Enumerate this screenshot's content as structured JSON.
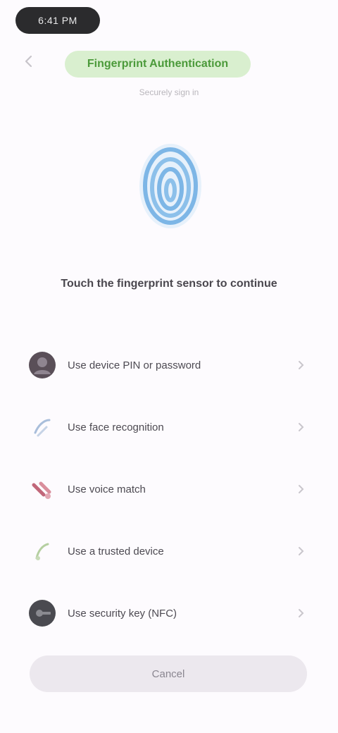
{
  "status": {
    "time": "6:41 PM"
  },
  "header": {
    "title": "Fingerprint Authentication",
    "subtitle": "Securely sign in"
  },
  "prompt": "Touch the fingerprint sensor to continue",
  "list": {
    "items": [
      {
        "label": "Use device PIN or password",
        "icon": "person-icon",
        "color": "#4a3f48"
      },
      {
        "label": "Use face recognition",
        "icon": "face-icon",
        "color": "#8fa9cc"
      },
      {
        "label": "Use voice match",
        "icon": "voice-icon",
        "color": "#b64a5a"
      },
      {
        "label": "Use a trusted device",
        "icon": "device-icon",
        "color": "#9fbd88"
      },
      {
        "label": "Use security key (NFC)",
        "icon": "key-icon",
        "color": "#3a3a3f"
      }
    ]
  },
  "bottom_button": {
    "label": "Cancel"
  },
  "colors": {
    "accent": "#4b9a3a",
    "accent_bg": "#d9efcf",
    "fingerprint": "#7db6e6",
    "background": "#fdfbfe"
  }
}
